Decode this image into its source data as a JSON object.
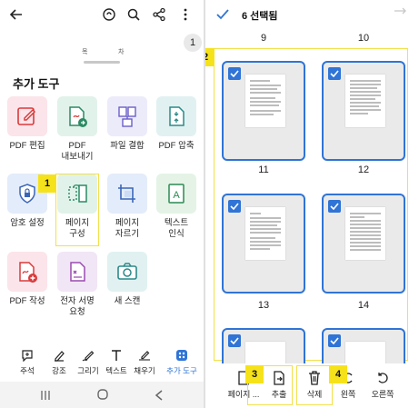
{
  "left_panel": {
    "toc_tabs": [
      "목",
      "차"
    ],
    "page_indicator": "1",
    "sheet_title": "추가 도구",
    "tools": [
      {
        "label": "PDF 편집",
        "icon": "pdf-edit-icon"
      },
      {
        "label": "PDF\n내보내기",
        "icon": "pdf-export-icon"
      },
      {
        "label": "파일 결합",
        "icon": "file-combine-icon"
      },
      {
        "label": "PDF 압축",
        "icon": "pdf-compress-icon"
      },
      {
        "label": "암호 설정",
        "icon": "password-lock-icon"
      },
      {
        "label": "페이지\n구성",
        "icon": "organize-pages-icon"
      },
      {
        "label": "페이지\n자르기",
        "icon": "crop-page-icon"
      },
      {
        "label": "텍스트\n인식",
        "icon": "text-recognition-icon"
      },
      {
        "label": "PDF 작성",
        "icon": "pdf-create-icon"
      },
      {
        "label": "전자 서명\n요청",
        "icon": "esign-request-icon"
      },
      {
        "label": "새 스캔",
        "icon": "camera-scan-icon"
      }
    ],
    "bottom_tools": [
      {
        "label": "주석",
        "icon": "comment-icon"
      },
      {
        "label": "강조",
        "icon": "highlight-icon"
      },
      {
        "label": "그리기",
        "icon": "draw-icon"
      },
      {
        "label": "텍스트",
        "icon": "text-icon"
      },
      {
        "label": "채우기",
        "icon": "fill-sign-icon"
      },
      {
        "label": "추가 도구",
        "icon": "more-tools-icon"
      }
    ],
    "annotation_1": "1"
  },
  "right_panel": {
    "selection_title": "6 선택됨",
    "page_labels_top": [
      "9",
      "10"
    ],
    "page_labels": [
      "11",
      "12",
      "13",
      "14"
    ],
    "bottom_actions": [
      {
        "label": "페이지 ...",
        "icon": "insert-page-icon"
      },
      {
        "label": "추출",
        "icon": "extract-icon"
      },
      {
        "label": "삭제",
        "icon": "trash-icon"
      },
      {
        "label": "왼쪽",
        "icon": "rotate-left-icon"
      },
      {
        "label": "오른쪽",
        "icon": "rotate-right-icon"
      }
    ],
    "annotation_2": "2",
    "annotation_3": "3",
    "annotation_4": "4"
  },
  "colors": {
    "accent": "#2f74d6",
    "highlight": "#f6e21a",
    "pdf_red": "#d93b3b"
  }
}
